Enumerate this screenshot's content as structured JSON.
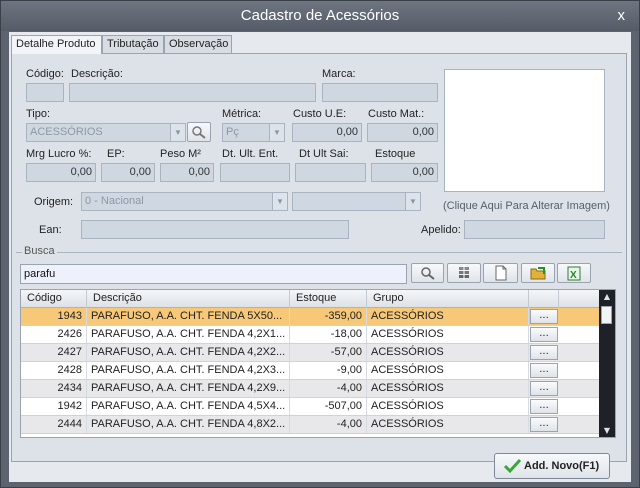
{
  "window": {
    "title": "Cadastro de Acessórios",
    "close_label": "x"
  },
  "tabs": [
    {
      "label": "Detalhe Produto"
    },
    {
      "label": "Tributação"
    },
    {
      "label": "Observação"
    }
  ],
  "form": {
    "codigo": {
      "label": "Código:",
      "value": ""
    },
    "descricao": {
      "label": "Descrição:",
      "value": ""
    },
    "marca": {
      "label": "Marca:",
      "value": ""
    },
    "tipo": {
      "label": "Tipo:",
      "value": "ACESSÓRIOS"
    },
    "metrica": {
      "label": "Métrica:",
      "value": "Pç"
    },
    "custo_ue": {
      "label": "Custo U.E:",
      "value": "0,00"
    },
    "custo_mat": {
      "label": "Custo Mat.:",
      "value": "0,00"
    },
    "mrg_lucro": {
      "label": "Mrg Lucro %:",
      "value": "0,00"
    },
    "ep": {
      "label": "EP:",
      "value": "0,00"
    },
    "peso": {
      "label": "Peso M²",
      "value": "0,00"
    },
    "dt_ult_ent": {
      "label": "Dt. Ult. Ent.",
      "value": ""
    },
    "dt_ult_sai": {
      "label": "Dt Ult Sai:",
      "value": ""
    },
    "estoque": {
      "label": "Estoque",
      "value": "0,00"
    },
    "origem": {
      "label": "Origem:",
      "value": "0 - Nacional",
      "value2": ""
    },
    "ean": {
      "label": "Ean:",
      "value": ""
    },
    "apelido": {
      "label": "Apelido:",
      "value": ""
    },
    "image_caption": "(Clique Aqui Para Alterar Imagem)"
  },
  "busca": {
    "title": "Busca",
    "value": "parafu"
  },
  "grid": {
    "columns": [
      "Código",
      "Descrição",
      "Estoque",
      "Grupo"
    ],
    "button_label": "...",
    "selected_row": 0,
    "rows": [
      {
        "codigo": "1943",
        "descricao": "PARAFUSO, A.A. CHT. FENDA  5X50...",
        "estoque": "-359,00",
        "grupo": "ACESSÓRIOS"
      },
      {
        "codigo": "2426",
        "descricao": "PARAFUSO, A.A. CHT. FENDA 4,2X1...",
        "estoque": "-18,00",
        "grupo": "ACESSÓRIOS"
      },
      {
        "codigo": "2427",
        "descricao": "PARAFUSO, A.A. CHT. FENDA 4,2X2...",
        "estoque": "-57,00",
        "grupo": "ACESSÓRIOS"
      },
      {
        "codigo": "2428",
        "descricao": "PARAFUSO, A.A. CHT. FENDA 4,2X3...",
        "estoque": "-9,00",
        "grupo": "ACESSÓRIOS"
      },
      {
        "codigo": "2434",
        "descricao": "PARAFUSO, A.A. CHT. FENDA 4,2X9...",
        "estoque": "-4,00",
        "grupo": "ACESSÓRIOS"
      },
      {
        "codigo": "1942",
        "descricao": "PARAFUSO, A.A. CHT. FENDA 4,5X4...",
        "estoque": "-507,00",
        "grupo": "ACESSÓRIOS"
      },
      {
        "codigo": "2444",
        "descricao": "PARAFUSO, A.A. CHT. FENDA 4,8X2...",
        "estoque": "-4,00",
        "grupo": "ACESSÓRIOS"
      }
    ]
  },
  "footer": {
    "add_label": "Add. Novo(F1)"
  },
  "colors": {
    "selected_row": "#f7c878",
    "title_bar": "#5d6470",
    "panel": "#dde2e9",
    "scrollbar": "#1e2127",
    "check_icon": "#3aa836"
  }
}
